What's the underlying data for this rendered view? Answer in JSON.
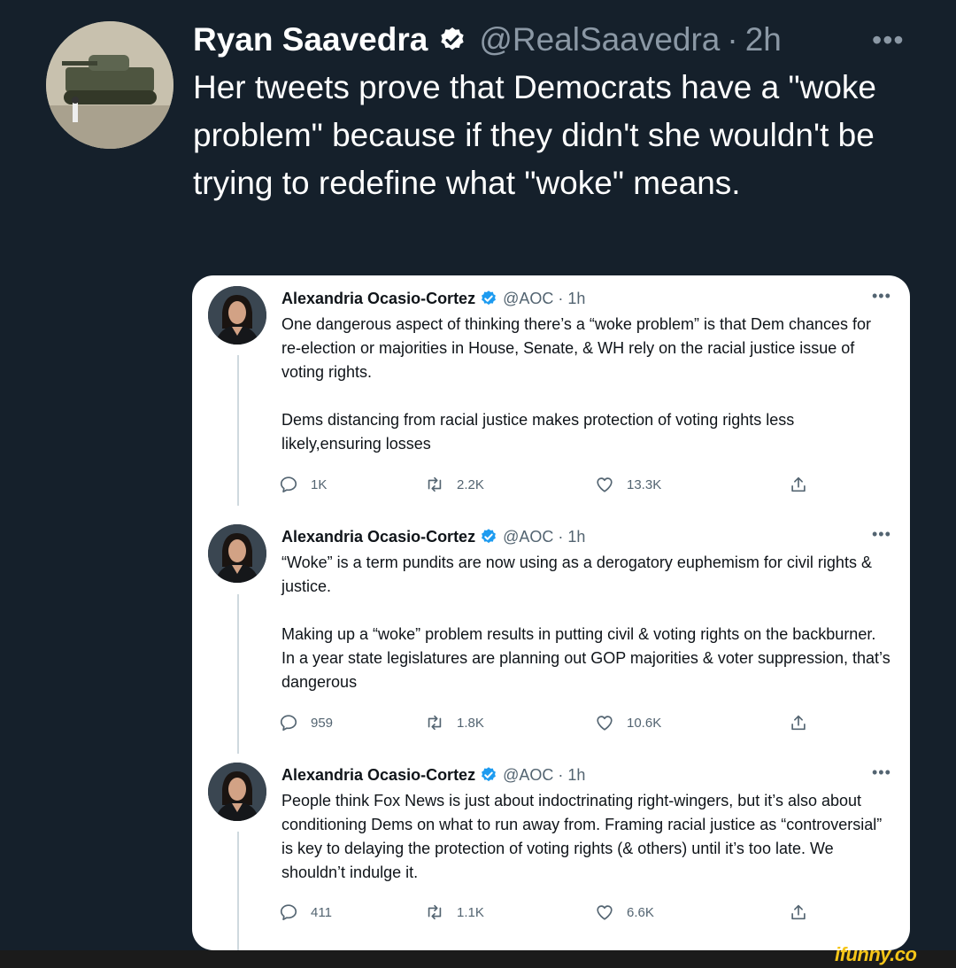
{
  "outer_tweet": {
    "name": "Ryan Saavedra",
    "handle": "@RealSaavedra",
    "separator": "·",
    "time": "2h",
    "more": "•••",
    "text": "Her tweets prove that Democrats have a \"woke problem\" because if they didn't she wouldn't be trying to redefine what \"woke\" means."
  },
  "quoted_tweets": [
    {
      "name": "Alexandria Ocasio-Cortez",
      "handle": "@AOC",
      "separator": "·",
      "time": "1h",
      "more": "•••",
      "text": "One dangerous aspect of thinking there’s a “woke problem” is that Dem chances for re-election or majorities in House, Senate, & WH rely on the racial justice issue of voting rights.\n\nDems distancing from racial justice makes protection of voting rights less likely,ensuring losses",
      "replies": "1K",
      "retweets": "2.2K",
      "likes": "13.3K"
    },
    {
      "name": "Alexandria Ocasio-Cortez",
      "handle": "@AOC",
      "separator": "·",
      "time": "1h",
      "more": "•••",
      "text": "“Woke” is a term pundits are now using as a derogatory euphemism for civil rights & justice.\n\nMaking up a “woke” problem results in putting civil & voting rights on the backburner. In a year state legislatures are planning out GOP majorities & voter suppression, that’s dangerous",
      "replies": "959",
      "retweets": "1.8K",
      "likes": "10.6K"
    },
    {
      "name": "Alexandria Ocasio-Cortez",
      "handle": "@AOC",
      "separator": "·",
      "time": "1h",
      "more": "•••",
      "text": "People think Fox News is just about indoctrinating right-wingers, but it’s also about conditioning Dems on what to run away from. Framing racial justice as “controversial” is key to delaying the protection of voting rights (& others) until it’s too late. We shouldn’t indulge it.",
      "replies": "411",
      "retweets": "1.1K",
      "likes": "6.6K"
    }
  ],
  "watermark": "ifunny.co",
  "colors": {
    "background": "#15202b",
    "verified": "#1d9bf0",
    "text_secondary": "#536471",
    "watermark": "#f5c518"
  },
  "icons": [
    "verified-badge-icon",
    "reply-icon",
    "retweet-icon",
    "like-icon",
    "share-icon",
    "more-icon"
  ]
}
